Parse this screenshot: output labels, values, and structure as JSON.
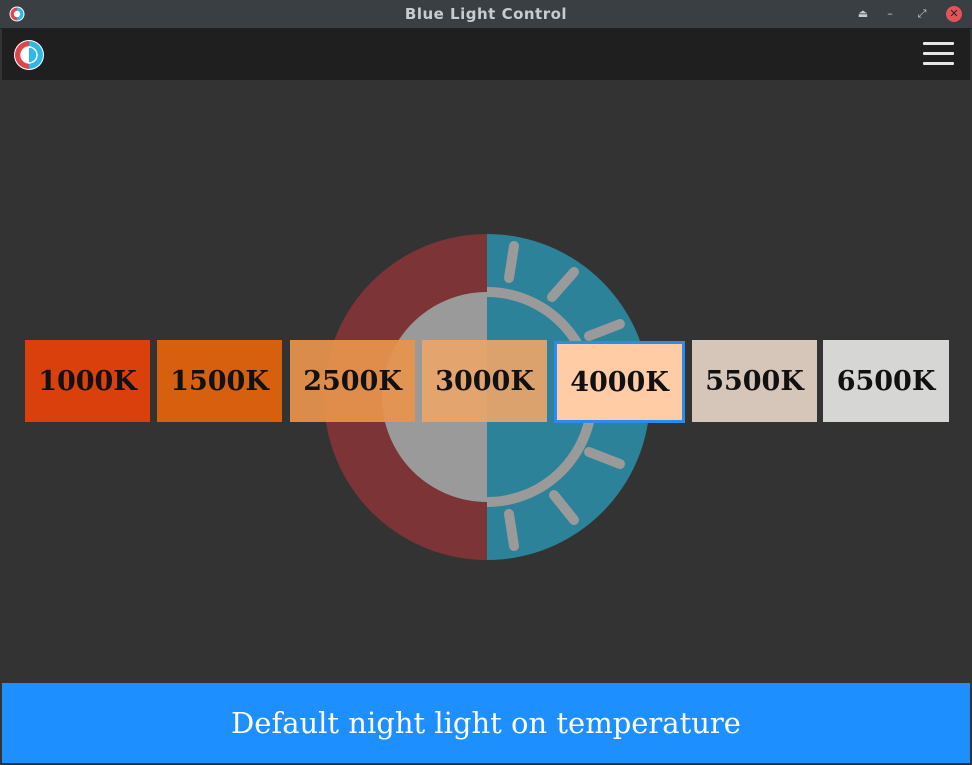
{
  "window": {
    "title": "Blue Light Control"
  },
  "colors": {
    "accent": "#1e8fff",
    "titlebar": "#3a3f44",
    "appbar": "#1f1f1f",
    "background": "#333333",
    "logo_red": "#e0454a",
    "logo_blue": "#2fb8e6"
  },
  "icons": {
    "app": "half-sun-icon",
    "menu": "hamburger-menu-icon",
    "window_buttons": [
      "keep-above-icon",
      "minimize-icon",
      "restore-icon",
      "close-icon"
    ]
  },
  "temperatures": [
    {
      "label": "1000K",
      "color": "#d9400c",
      "selected": false
    },
    {
      "label": "1500K",
      "color": "#d6600e",
      "selected": false
    },
    {
      "label": "2500K",
      "color": "#e8944d",
      "selected": false
    },
    {
      "label": "3000K",
      "color": "#eaa56a",
      "selected": false
    },
    {
      "label": "4000K",
      "color": "#ffcca6",
      "selected": true
    },
    {
      "label": "5500K",
      "color": "#d6c6ba",
      "selected": false
    },
    {
      "label": "6500K",
      "color": "#d6d6d4",
      "selected": false
    }
  ],
  "footer": {
    "label": "Default night light on temperature"
  }
}
